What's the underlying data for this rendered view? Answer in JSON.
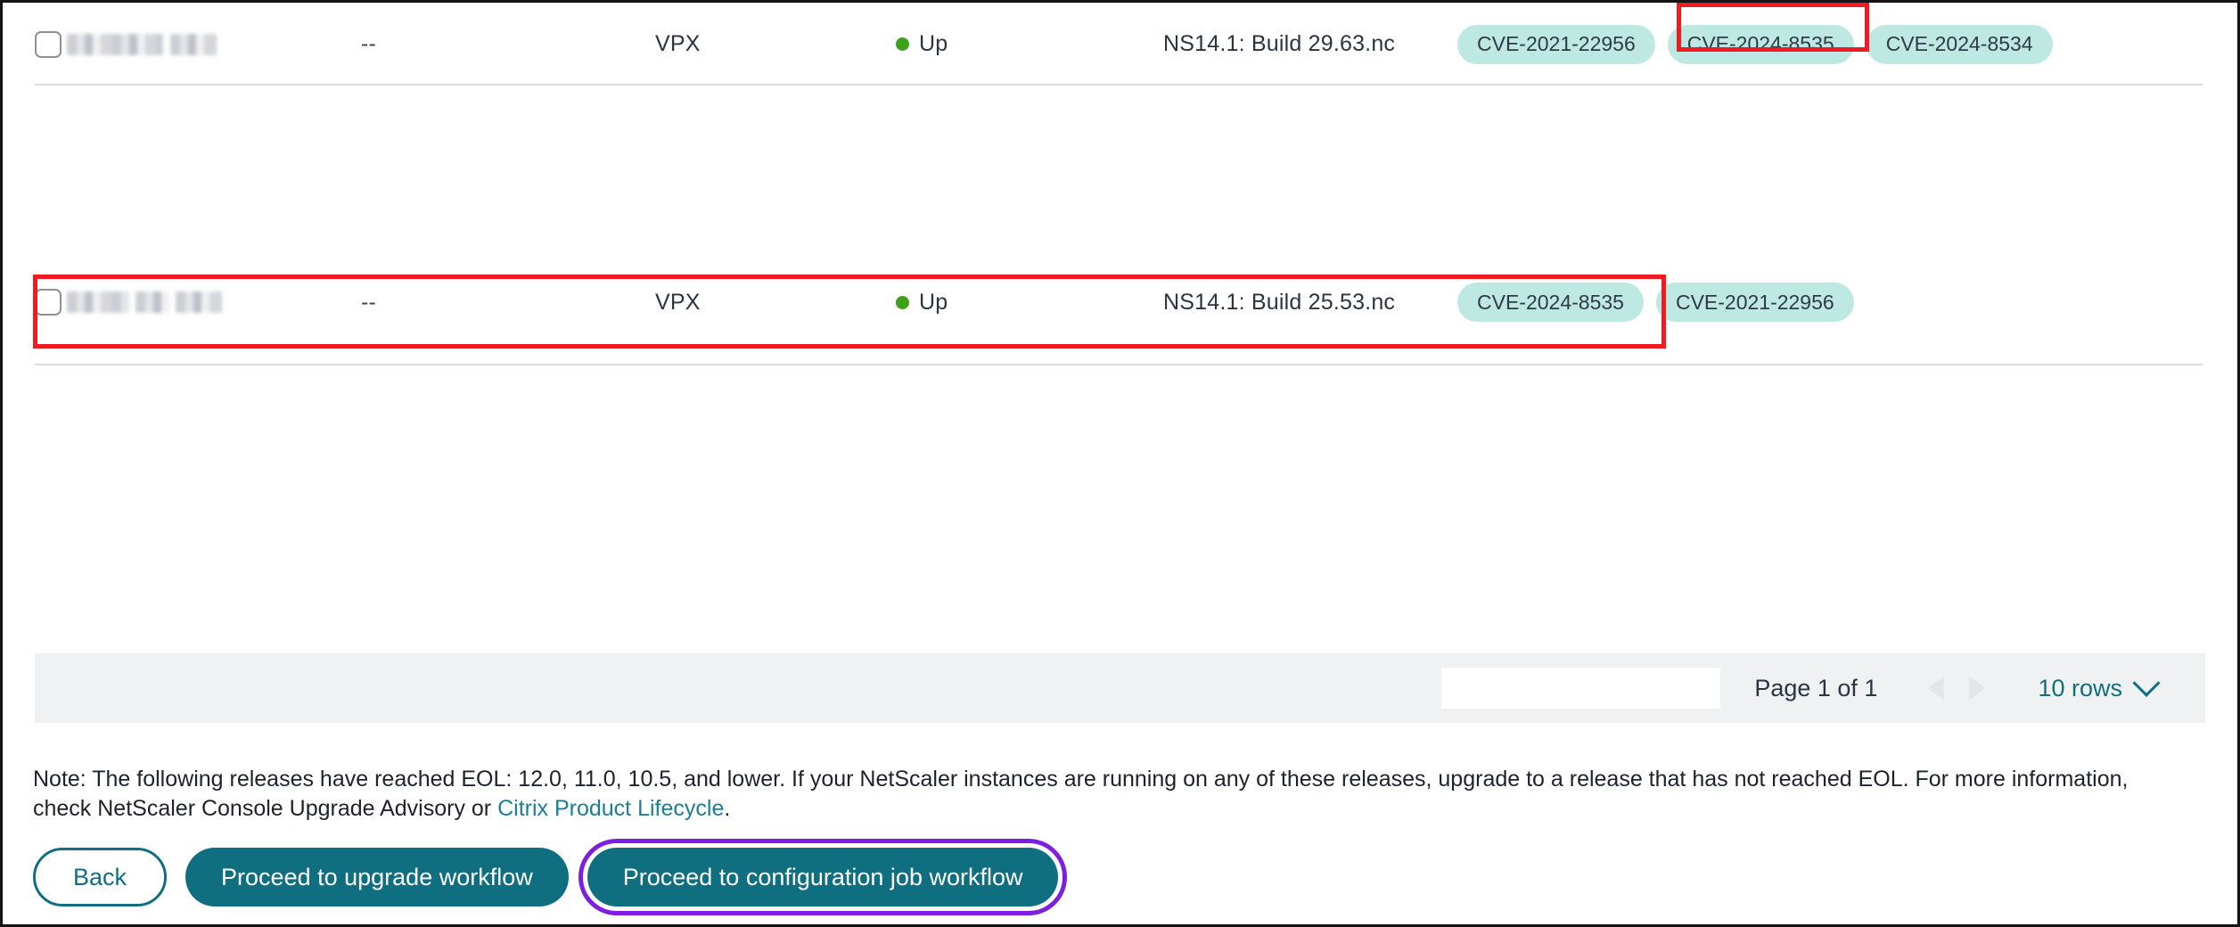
{
  "table": {
    "rows": [
      {
        "id": "row-1",
        "host_redacted": true,
        "ip": "--",
        "type": "VPX",
        "state": "Up",
        "state_color": "#3da11a",
        "version": "NS14.1: Build 29.63.nc",
        "cves": [
          "CVE-2021-22956",
          "CVE-2024-8535",
          "CVE-2024-8534"
        ],
        "highlighted_cve": "CVE-2024-8535",
        "checked": false
      },
      {
        "id": "row-2",
        "host_redacted": true,
        "ip": "--",
        "type": "VPX",
        "state": "Up",
        "state_color": "#3da11a",
        "version": "NS14.1: Build 25.53.nc",
        "cves": [
          "CVE-2024-8535",
          "CVE-2021-22956"
        ],
        "highlighted_cve": "CVE-2024-8535",
        "checked": false,
        "row_highlighted": true
      }
    ]
  },
  "pagination": {
    "input_value": "",
    "input_placeholder": "",
    "page_label": "Page 1 of 1",
    "prev_label": "previous-page",
    "next_label": "next-page",
    "rows_per_page": "10 rows"
  },
  "note": {
    "prefix": "Note: The following releases have reached EOL: 12.0, 11.0, 10.5, and lower. If your NetScaler instances are running on any of these releases, upgrade to a release that has not reached EOL. For more information, check NetScaler Console Upgrade Advisory or ",
    "link_text": "Citrix Product Lifecycle",
    "suffix": "."
  },
  "buttons": {
    "back": "Back",
    "upgrade": "Proceed to upgrade workflow",
    "config_job": "Proceed to configuration job workflow"
  },
  "colors": {
    "teal": "#0f6f80",
    "chip_bg": "#bde9e2",
    "status_green": "#3da11a",
    "annotation_red": "#ee1c21",
    "focus_purple": "#7d1fe0",
    "link_teal": "#1a7f94"
  }
}
